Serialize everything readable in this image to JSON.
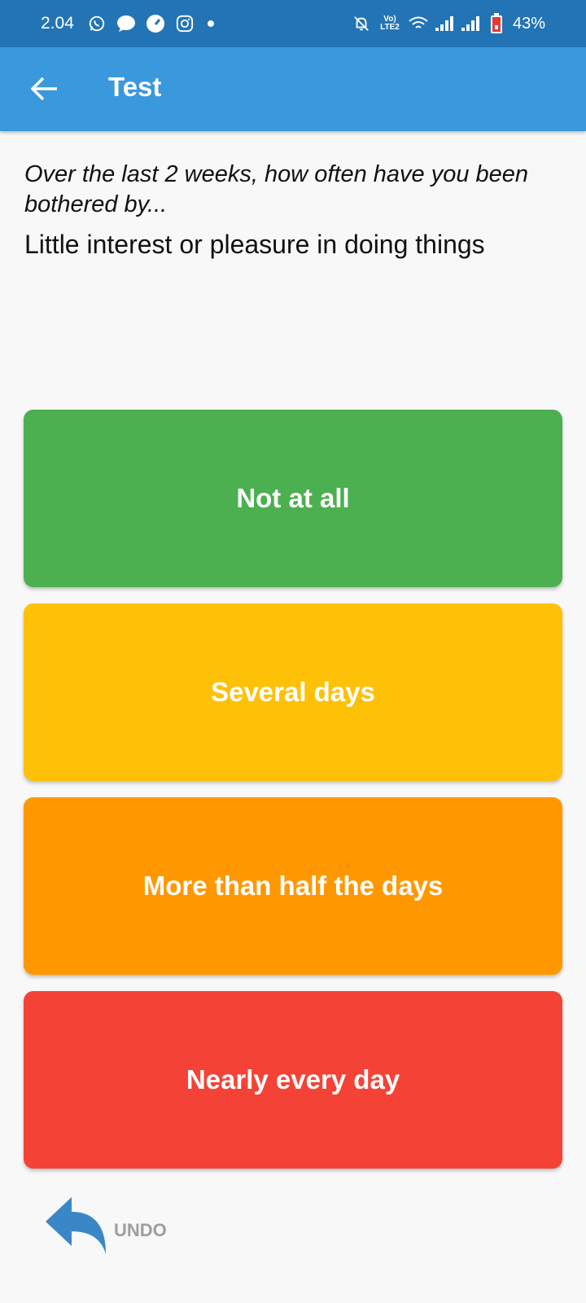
{
  "status_bar": {
    "time": "2.04",
    "network_label": "Vo)) 1\nLTE2",
    "battery": "43%"
  },
  "app_bar": {
    "title": "Test"
  },
  "prompt": "Over the last 2 weeks, how often have you been bothered by...",
  "question": "Little interest or pleasure in doing things",
  "answers": [
    {
      "label": "Not at all",
      "color": "#4caf50"
    },
    {
      "label": "Several days",
      "color": "#ffc107"
    },
    {
      "label": "More than half the days",
      "color": "#ff9800"
    },
    {
      "label": "Nearly every day",
      "color": "#f44336"
    }
  ],
  "undo": {
    "label": "UNDO",
    "icon_color": "#3a87c8"
  },
  "colors": {
    "status_bar": "#2274b5",
    "app_bar": "#3a98dd",
    "background": "#f8f8f8"
  },
  "icons": {
    "status_left": [
      "whatsapp-icon",
      "message-icon",
      "speedometer-icon",
      "instagram-icon",
      "dot-icon"
    ],
    "status_right": [
      "mute-bell-icon",
      "volte-icon",
      "wifi-icon",
      "signal-icon",
      "signal-icon",
      "battery-icon"
    ],
    "app_bar": "back-arrow-icon",
    "undo": "undo-arrow-icon"
  }
}
